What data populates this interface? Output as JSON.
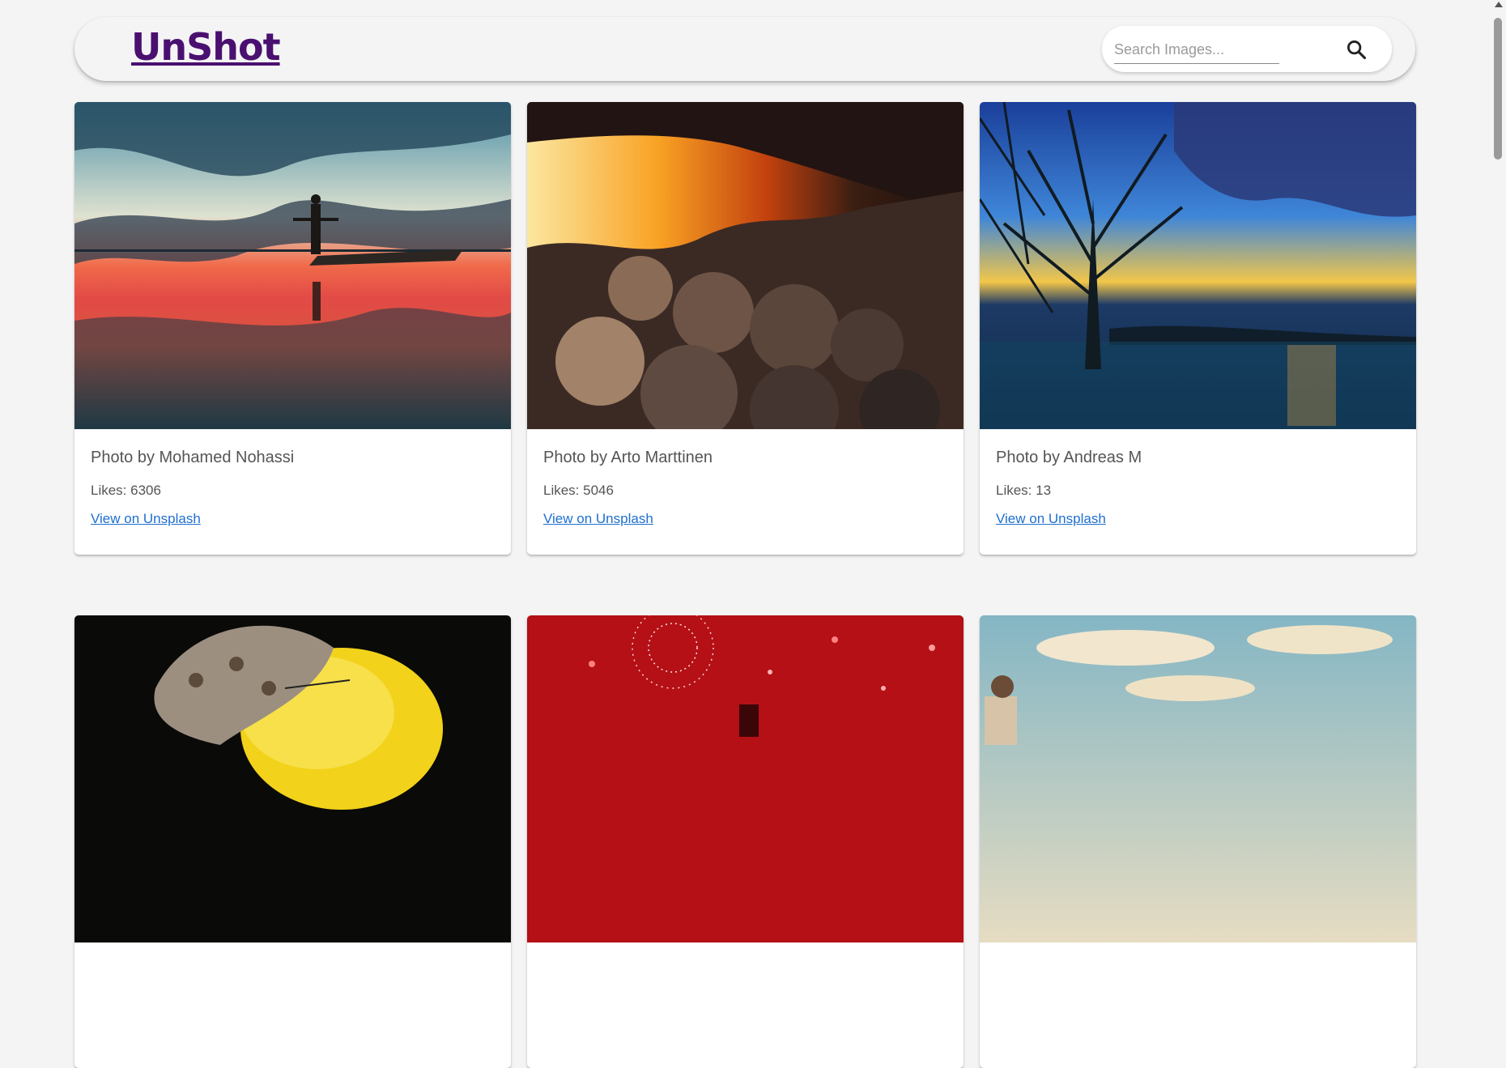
{
  "header": {
    "logo": "UnShot",
    "search_placeholder": "Search Images..."
  },
  "cards": [
    {
      "title": "Photo by Mohamed Nohassi",
      "likes": "Likes: 6306",
      "link": "View on Unsplash"
    },
    {
      "title": "Photo by Arto Marttinen",
      "likes": "Likes: 5046",
      "link": "View on Unsplash"
    },
    {
      "title": "Photo by Andreas M",
      "likes": "Likes: 13",
      "link": "View on Unsplash"
    }
  ],
  "colors": {
    "background": "#f4f4f4",
    "logo": "#4a1070",
    "link": "#1e6fd0"
  },
  "icons": {
    "search": "search-icon"
  }
}
